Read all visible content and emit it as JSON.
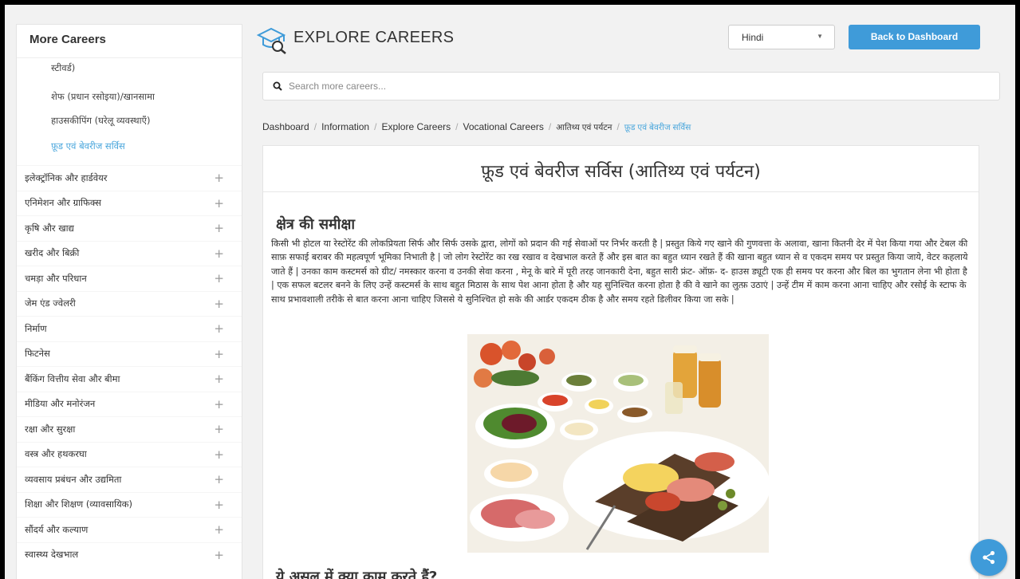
{
  "sidebar": {
    "title": "More Careers",
    "sub_items": [
      {
        "label": "स्टीवर्ड)",
        "active": false
      },
      {
        "label": "शेफ (प्रधान रसोइया)/खानसामा",
        "active": false
      },
      {
        "label": "हाउसकीपिंग (घरेलू व्यवस्थाएँ)",
        "active": false
      },
      {
        "label": "फ़ूड एवं बेवरीज सर्विस",
        "active": true
      }
    ],
    "categories": [
      "इलेक्ट्रॉनिक और हार्डवेयर",
      "एनिमेशन और ग्राफिक्स",
      "कृषि और खाद्य",
      "खरीद और बिक्री",
      "चमड़ा और परिधान",
      "जेम एंड ज्वेलरी",
      "निर्माण",
      "फिटनेस",
      "बैंकिंग वित्तीय सेवा और बीमा",
      "मीडिया और मनोरंजन",
      "रक्षा और सुरक्षा",
      "वस्त्र और हथकरघा",
      "व्यवसाय प्रबंधन और उद्यमिता",
      "शिक्षा और शिक्षण (व्यावसायिक)",
      "सौंदर्य और कल्याण",
      "स्वास्थ्य देखभाल"
    ],
    "expand_symbol": "+"
  },
  "header": {
    "title": "EXPLORE CAREERS",
    "language": "Hindi",
    "back_button": "Back to Dashboard"
  },
  "search": {
    "placeholder": "Search more careers..."
  },
  "breadcrumb": {
    "items": [
      "Dashboard",
      "Information",
      "Explore Careers",
      "Vocational Careers",
      "आतिथ्य एवं पर्यटन"
    ],
    "current": "फ़ूड एवं बेवरीज सर्विस"
  },
  "content": {
    "page_title": "फ़ूड एवं बेवरीज सर्विस (आतिथ्य एवं पर्यटन)",
    "overview_heading": "क्षेत्र की समीक्षा",
    "overview_text": "किसी भी होटल या रेस्टोरेंट की लोकप्रियता सिर्फ और सिर्फ उसके द्वारा, लोगों को प्रदान की गई सेवाओं पर निर्भर करती है | प्रस्तुत किये गए खाने की गुणवत्ता के अलावा, खाना कितनी देर में पेश किया गया और टेबल की साफ़ सफाई बराबर की महत्वपूर्ण भूमिका निभाती है | जो लोग रेस्टोरेंट का रख रखाव व देखभाल करते हैं और इस बात का बहुत ध्यान रखते हैं की खाना बहुत ध्यान से व एकदम समय पर प्रस्तुत किया जाये, वेटर कहलाये जाते हैं | उनका काम कस्टमर्स को ग्रीट/ नमस्कार करना व उनकी सेवा करना , मेनू के बारे में पूरी तरह जानकारी देना, बहुत सारी फ्रंट- ऑफ़- द- हाउस ड्यूटी एक ही समय पर करना और बिल का भुगतान लेना भी होता है | एक सफल बटलर बनने के लिए उन्हें कस्टमर्स के साथ बहुत मिठास के साथ पेश आना होता है और यह सुनिश्चित करना होता है की वे खाने का लुत्फ़ उठाएं | उन्हें टीम में काम करना आना चाहिए और रसोई के स्टाफ के साथ प्रभावशाली तरीके से बात करना आना चाहिए जिससे ये सुनिश्चित हो सके की आर्डर एकदम ठीक है और समय रहते डिलीवर किया जा सके |",
    "second_heading": "ये असल में क्या काम करते हैं?"
  },
  "colors": {
    "accent": "#3f9bd9",
    "active_link": "#49a6dc"
  }
}
